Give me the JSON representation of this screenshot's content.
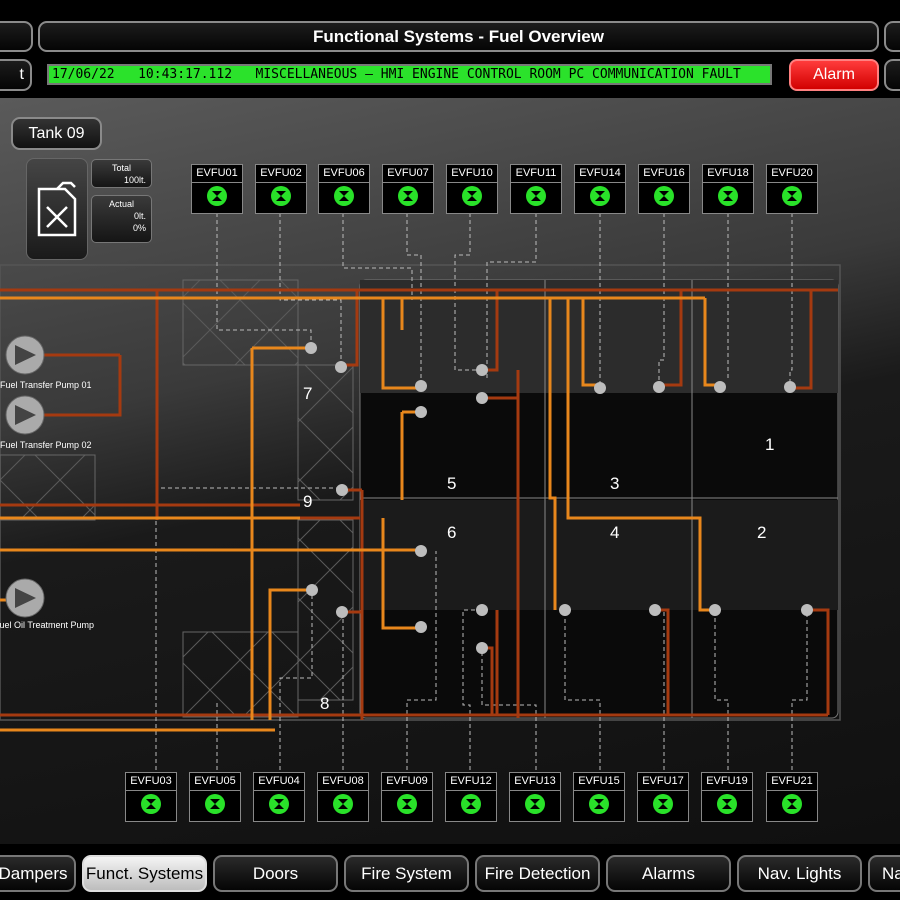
{
  "header": {
    "title": "Functional Systems - Fuel Overview"
  },
  "alarm_bar": {
    "date": "17/06/22",
    "time": "10:43:17.112",
    "message": "MISCELLANEOUS – HMI ENGINE CONTROL ROOM PC COMMUNICATION FAULT",
    "left_label": "t",
    "button_label": "Alarm"
  },
  "tank": {
    "button_label": "Tank 09",
    "total_label": "Total",
    "total_value": "100lt.",
    "actual_label": "Actual",
    "actual_value": "0lt.",
    "actual_percent": "0%",
    "icon": "fuel-can-icon"
  },
  "valves_top": [
    "EVFU01",
    "EVFU02",
    "EVFU06",
    "EVFU07",
    "EVFU10",
    "EVFU11",
    "EVFU14",
    "EVFU16",
    "EVFU18",
    "EVFU20"
  ],
  "valves_bottom": [
    "EVFU03",
    "EVFU05",
    "EVFU04",
    "EVFU08",
    "EVFU09",
    "EVFU12",
    "EVFU13",
    "EVFU15",
    "EVFU17",
    "EVFU19",
    "EVFU21"
  ],
  "pumps": [
    "Fuel Transfer Pump 01",
    "Fuel Transfer Pump 02",
    "Fuel Oil Treatment Pump"
  ],
  "tank_numbers": [
    "1",
    "2",
    "3",
    "4",
    "5",
    "6",
    "7",
    "8",
    "9"
  ],
  "nav": [
    "Dampers",
    "Funct. Systems",
    "Doors",
    "Fire System",
    "Fire Detection",
    "Alarms",
    "Nav. Lights",
    "Na"
  ],
  "colors": {
    "pipe_supply": "#e8871c",
    "pipe_return": "#a53a10",
    "valve_ok": "#29e229",
    "alarm": "#e60000"
  }
}
